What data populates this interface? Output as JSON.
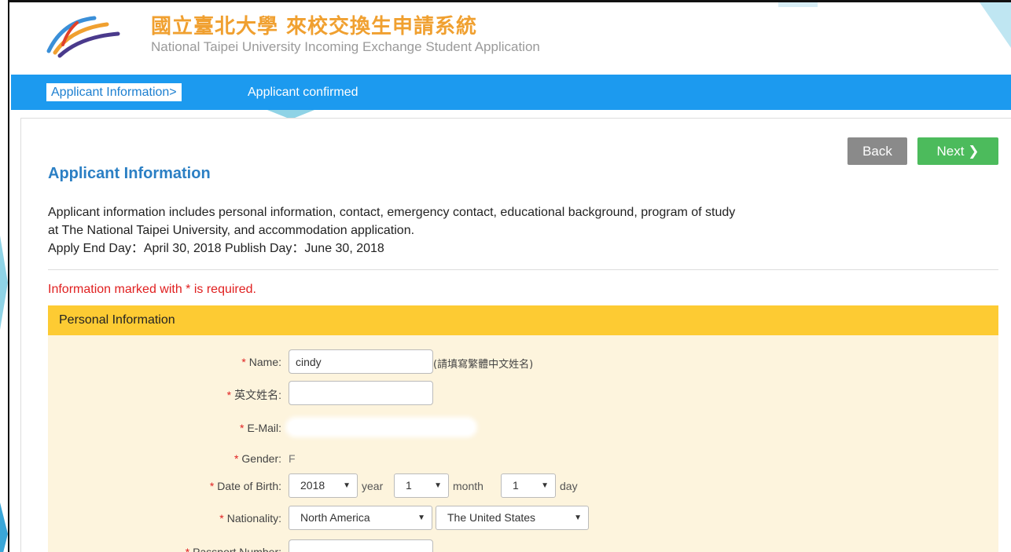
{
  "header": {
    "title_zh": "國立臺北大學 來校交換生申請系統",
    "title_en": "National Taipei University Incoming Exchange Student Application"
  },
  "breadcrumb": {
    "active": "Applicant Information>",
    "next": "Applicant confirmed"
  },
  "buttons": {
    "back": "Back",
    "next": "Next ❯"
  },
  "section": {
    "title": "Applicant Information",
    "intro_line1": "Applicant information includes personal information, contact, emergency contact, educational background, program of study",
    "intro_line2": "at The National Taipei University, and accommodation application.",
    "dates": "Apply End Day：April 30, 2018 Publish Day：June 30, 2018"
  },
  "required_note": "Information marked with * is required.",
  "panel": {
    "title": "Personal Information",
    "fields": {
      "name": {
        "label": "Name:",
        "value": "cindy",
        "hint": "(請填寫繁體中文姓名)"
      },
      "english_name": {
        "label": "英文姓名:",
        "value": ""
      },
      "email": {
        "label": "E-Mail:"
      },
      "gender": {
        "label": "Gender:",
        "value": "F"
      },
      "dob": {
        "label": "Date of Birth:",
        "year": "2018",
        "year_unit": "year",
        "month": "1",
        "month_unit": "month",
        "day": "1",
        "day_unit": "day"
      },
      "nationality": {
        "label": "Nationality:",
        "region": "North America",
        "country": "The United States"
      },
      "passport": {
        "label": "Passport Number:",
        "value": ""
      }
    }
  },
  "colors": {
    "navbar": "#1c9aef",
    "title_zh": "#f0a030",
    "panel_head": "#fdcb33",
    "panel_body": "#fdf4dd",
    "back_button": "#8a8a8a",
    "next_button": "#4cbb5c",
    "required": "#e02020"
  }
}
